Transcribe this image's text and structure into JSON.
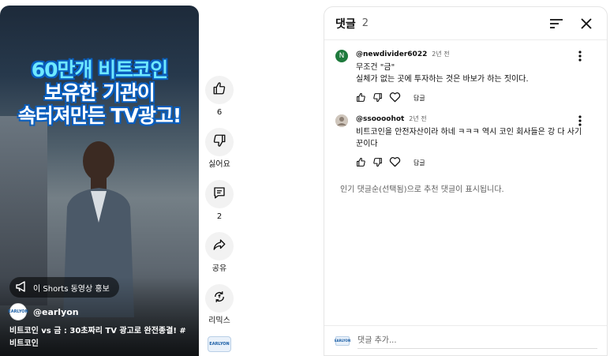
{
  "video": {
    "overlay_lines": [
      "60만개 비트코인",
      "보유한 기관이",
      "속터져만든 TV광고!"
    ],
    "promo_label": "이 Shorts 동영상 홍보",
    "channel_handle": "@earlyon",
    "channel_avatar_text": "EARLYON",
    "title": "비트코인 vs 금 : 30초짜리 TV 광고로 완전종결! #비트코인"
  },
  "actions": {
    "like_count": "6",
    "dislike_label": "싫어요",
    "comment_count": "2",
    "share_label": "공유",
    "remix_label": "리믹스",
    "avatar_text": "EARLYON"
  },
  "comments_panel": {
    "title": "댓글",
    "count": "2",
    "sort_icon": "sort-icon",
    "close_icon": "close-icon",
    "comments": [
      {
        "avatar_letter": "N",
        "avatar_color": "#1e7a3c",
        "author": "@newdivider6022",
        "time": "2년 전",
        "text_lines": [
          "무조건 \"금\"",
          "실체가 없는 곳에 투자하는 것은 바보가 하는 짓이다."
        ],
        "reply_label": "답글"
      },
      {
        "avatar_letter": "",
        "avatar_color": "#b8aca0",
        "author": "@ssoooohot",
        "time": "2년 전",
        "text_lines": [
          "비트코인을 안전자산이라 하네 ㅋㅋㅋ 역시 코인 회사들은 강 다 사기",
          "꾼이다"
        ],
        "reply_label": "답글"
      }
    ],
    "notice": "인기 댓글순(선택됨)으로 추천 댓글이 표시됩니다.",
    "add_comment_placeholder": "댓글 추가...",
    "footer_avatar_text": "EARLYON"
  }
}
